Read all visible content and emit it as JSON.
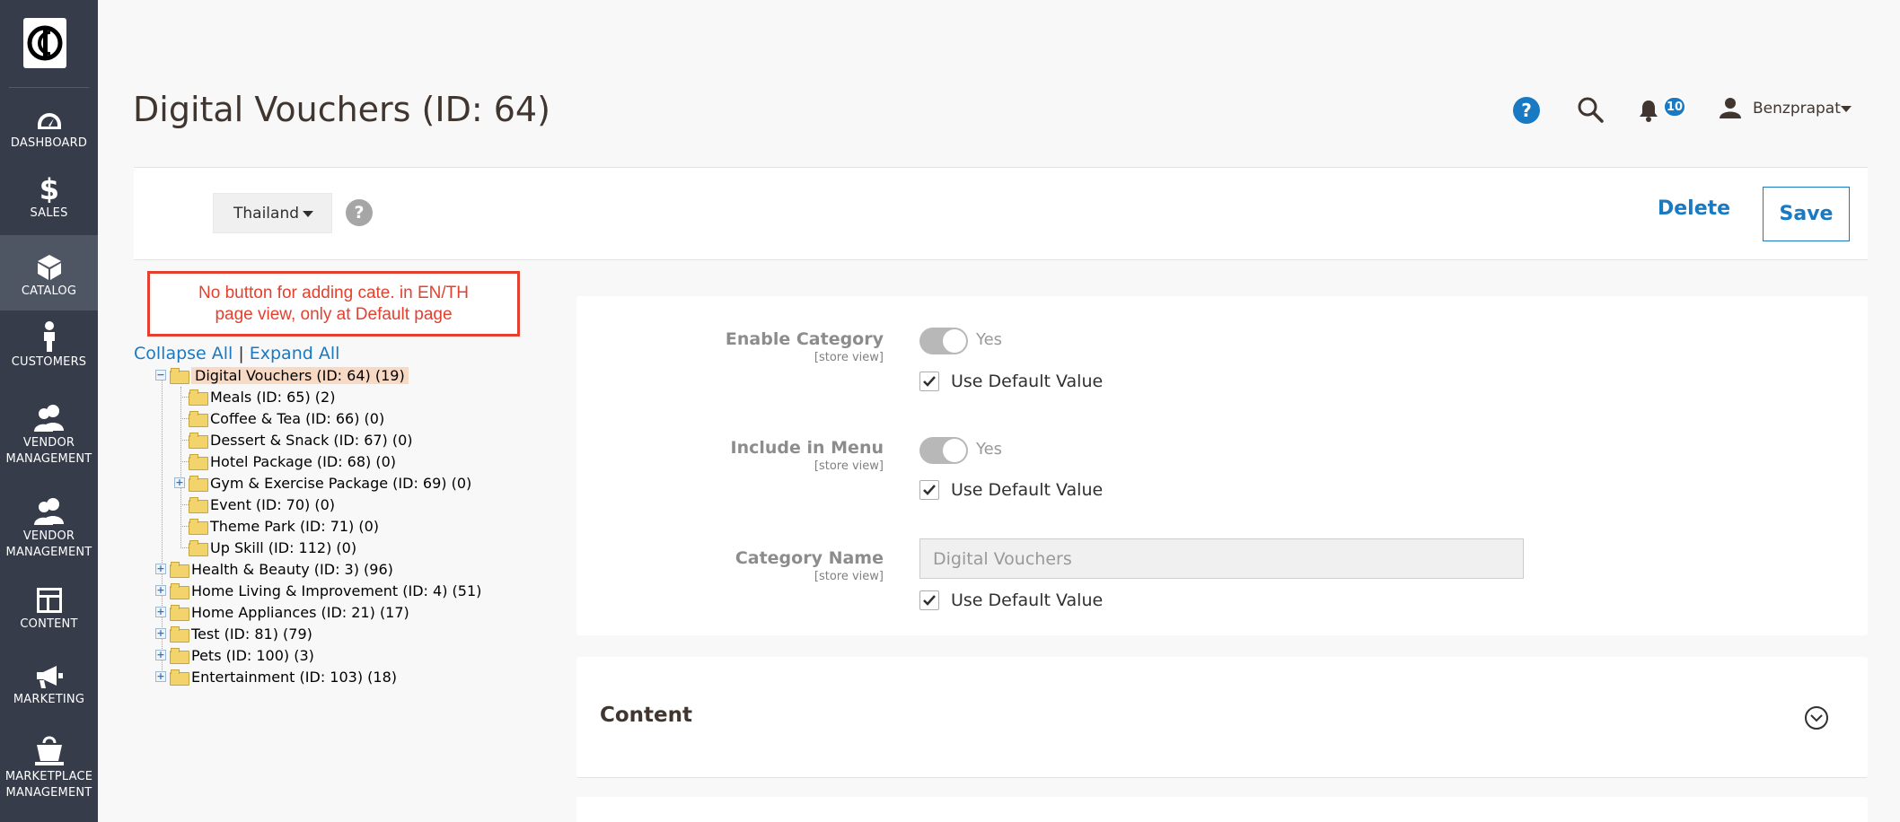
{
  "sidebar": {
    "items": [
      {
        "label": "DASHBOARD",
        "icon": "dashboard-icon"
      },
      {
        "label": "SALES",
        "icon": "dollar-icon"
      },
      {
        "label": "CATALOG",
        "icon": "box-icon",
        "active": true
      },
      {
        "label": "CUSTOMERS",
        "icon": "person-icon"
      },
      {
        "label": "VENDOR\nMANAGEMENT",
        "icon": "users-icon"
      },
      {
        "label": "VENDOR\nMANAGEMENT",
        "icon": "users-icon"
      },
      {
        "label": "CONTENT",
        "icon": "layout-icon"
      },
      {
        "label": "MARKETING",
        "icon": "megaphone-icon"
      },
      {
        "label": "MARKETPLACE\nMANAGEMENT",
        "icon": "bag-icon"
      }
    ]
  },
  "header": {
    "title": "Digital Vouchers (ID: 64)",
    "help": "?",
    "notifications": "10",
    "user": "Benzprapat"
  },
  "action_bar": {
    "store_view": "Thailand",
    "scope_help": "?",
    "delete_label": "Delete",
    "save_label": "Save"
  },
  "annotation": {
    "line1": "No button for adding cate. in EN/TH",
    "line2": "page view, only at Default page"
  },
  "tree": {
    "collapse_all": "Collapse All",
    "separator": "|",
    "expand_all": "Expand All",
    "nodes": [
      {
        "label": "Digital Vouchers (ID: 64) (19)",
        "level": 0,
        "expander": "−",
        "selected": true
      },
      {
        "label": "Meals (ID: 65) (2)",
        "level": 1
      },
      {
        "label": "Coffee & Tea (ID: 66) (0)",
        "level": 1
      },
      {
        "label": "Dessert & Snack (ID: 67) (0)",
        "level": 1
      },
      {
        "label": "Hotel Package (ID: 68) (0)",
        "level": 1
      },
      {
        "label": "Gym & Exercise Package (ID: 69) (0)",
        "level": 1,
        "expander": "+"
      },
      {
        "label": "Event (ID: 70) (0)",
        "level": 1
      },
      {
        "label": "Theme Park (ID: 71) (0)",
        "level": 1
      },
      {
        "label": "Up Skill (ID: 112) (0)",
        "level": 1
      },
      {
        "label": "Health & Beauty (ID: 3) (96)",
        "level": 0,
        "expander": "+"
      },
      {
        "label": "Home Living & Improvement (ID: 4) (51)",
        "level": 0,
        "expander": "+"
      },
      {
        "label": "Home Appliances (ID: 21) (17)",
        "level": 0,
        "expander": "+"
      },
      {
        "label": "Test (ID: 81) (79)",
        "level": 0,
        "expander": "+"
      },
      {
        "label": "Pets (ID: 100) (3)",
        "level": 0,
        "expander": "+"
      },
      {
        "label": "Entertainment (ID: 103) (18)",
        "level": 0,
        "expander": "+"
      }
    ]
  },
  "form": {
    "enable_category": {
      "label": "Enable Category",
      "scope": "[store view]",
      "toggle_text": "Yes",
      "use_default": "Use Default Value"
    },
    "include_in_menu": {
      "label": "Include in Menu",
      "scope": "[store view]",
      "toggle_text": "Yes",
      "use_default": "Use Default Value"
    },
    "category_name": {
      "label": "Category Name",
      "scope": "[store view]",
      "value": "Digital Vouchers",
      "use_default": "Use Default Value"
    }
  },
  "content_section": {
    "title": "Content"
  },
  "colors": {
    "sidebar_bg": "#373c4a",
    "accent": "#1979c3",
    "annotation": "#e3402f"
  }
}
